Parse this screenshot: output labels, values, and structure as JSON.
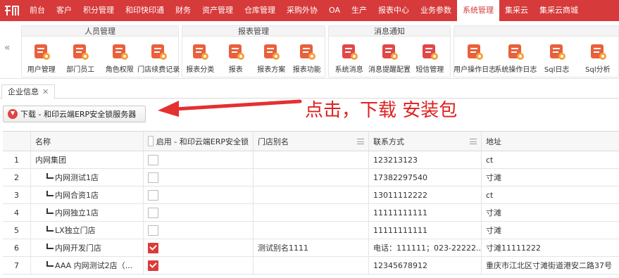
{
  "nav": {
    "items": [
      "前台",
      "客户",
      "积分管理",
      "和印快印通",
      "财务",
      "资产管理",
      "仓库管理",
      "采购外协",
      "OA",
      "生产",
      "报表中心",
      "业务参数",
      "系统管理",
      "集采云",
      "集采云商城"
    ],
    "active": "系统管理"
  },
  "ribbon": {
    "groups": [
      {
        "title": "人员管理",
        "items": [
          {
            "label": "用户管理",
            "icon": "user-manage-icon"
          },
          {
            "label": "部门员工",
            "icon": "department-staff-icon"
          },
          {
            "label": "角色权限",
            "icon": "role-permission-icon"
          },
          {
            "label": "门店续费记录",
            "icon": "store-renewal-icon"
          }
        ]
      },
      {
        "title": "报表管理",
        "items": [
          {
            "label": "报表分类",
            "icon": "report-category-icon"
          },
          {
            "label": "报表",
            "icon": "report-icon"
          },
          {
            "label": "报表方案",
            "icon": "report-scheme-icon"
          },
          {
            "label": "报表功能",
            "icon": "report-function-icon"
          }
        ]
      },
      {
        "title": "消息通知",
        "items": [
          {
            "label": "系统消息",
            "icon": "system-message-icon"
          },
          {
            "label": "消息提醒配置",
            "icon": "message-reminder-icon"
          },
          {
            "label": "短信管理",
            "icon": "sms-manage-icon"
          }
        ]
      },
      {
        "title": "",
        "items": [
          {
            "label": "用户操作日志",
            "icon": "user-log-icon"
          },
          {
            "label": "系统操作日志",
            "icon": "system-log-icon"
          },
          {
            "label": "Sql日志",
            "icon": "sql-log-icon"
          },
          {
            "label": "Sql分析",
            "icon": "sql-analysis-icon"
          }
        ]
      }
    ]
  },
  "tab": {
    "label": "企业信息",
    "close": "✕"
  },
  "download_button": {
    "label": "下载 - 和印云端ERP安全锁服务器"
  },
  "annotation": {
    "text": "点击，下载 安装包"
  },
  "table": {
    "columns": [
      "",
      "名称",
      "启用 - 和印云端ERP安全锁",
      "门店别名",
      "联系方式",
      "地址"
    ],
    "rows": [
      {
        "no": "1",
        "name": "内网集团",
        "child": false,
        "enabled": false,
        "alias": "",
        "contact": "123213123",
        "address": "ct"
      },
      {
        "no": "2",
        "name": "内网测试1店",
        "child": true,
        "enabled": false,
        "alias": "",
        "contact": "17382297540",
        "address": "寸滩"
      },
      {
        "no": "3",
        "name": "内网合资1店",
        "child": true,
        "enabled": false,
        "alias": "",
        "contact": "13011112222",
        "address": "ct"
      },
      {
        "no": "4",
        "name": "内网独立1店",
        "child": true,
        "enabled": false,
        "alias": "",
        "contact": "11111111111",
        "address": "寸滩"
      },
      {
        "no": "5",
        "name": "LX独立门店",
        "child": true,
        "enabled": false,
        "alias": "",
        "contact": "11111111111",
        "address": "寸滩"
      },
      {
        "no": "6",
        "name": "内网开发门店",
        "child": true,
        "enabled": true,
        "alias": "测试别名1111",
        "contact": "电话：111111；023-22222...",
        "address": "寸滩11111222"
      },
      {
        "no": "7",
        "name": "AAA 内网测试2店（...",
        "child": true,
        "enabled": true,
        "alias": "",
        "contact": "12345678912",
        "address": "重庆市江北区寸滩街道港安二路37号"
      }
    ]
  },
  "colors": {
    "brand": "#d63a3a",
    "annotation": "#e02020"
  }
}
